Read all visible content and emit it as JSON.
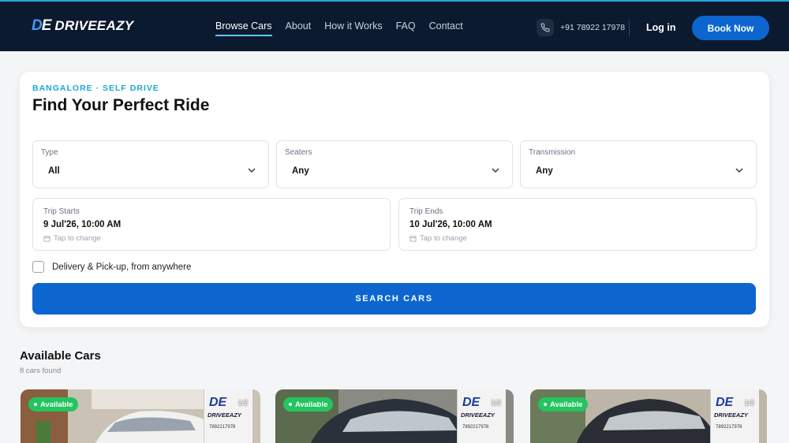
{
  "header": {
    "logo_mark_d": "D",
    "logo_mark_e": "E",
    "logo_text": "DRIVEEAZY",
    "nav": [
      {
        "label": "Browse Cars",
        "active": true
      },
      {
        "label": "About",
        "active": false
      },
      {
        "label": "How it Works",
        "active": false
      },
      {
        "label": "FAQ",
        "active": false
      },
      {
        "label": "Contact",
        "active": false
      }
    ],
    "phone": "+91 78922 17978",
    "login_label": "Log in",
    "book_label": "Book Now"
  },
  "search": {
    "eyebrow": "BANGALORE · SELF DRIVE",
    "title": "Find Your Perfect Ride",
    "filters": [
      {
        "label": "Type",
        "value": "All"
      },
      {
        "label": "Seaters",
        "value": "Any"
      },
      {
        "label": "Transmission",
        "value": "Any"
      }
    ],
    "trip_start": {
      "label": "Trip Starts",
      "value": "9 Jul'26, 10:00 AM",
      "hint": "Tap to change"
    },
    "trip_end": {
      "label": "Trip Ends",
      "value": "10 Jul'26, 10:00 AM",
      "hint": "Tap to change"
    },
    "delivery_label": "Delivery & Pick-up, from anywhere",
    "delivery_checked": false,
    "button_label": "SEARCH CARS"
  },
  "results": {
    "title": "Available Cars",
    "count": "8 cars found",
    "cars": [
      {
        "status": "Available",
        "counter": "1/2",
        "banner_logo": "DE",
        "banner_name": "DRIVEEAZY",
        "banner_phone": "7892217978"
      },
      {
        "status": "Available",
        "counter": "1/2",
        "banner_logo": "DE",
        "banner_name": "DRIVEEAZY",
        "banner_phone": "7892217978"
      },
      {
        "status": "Available",
        "counter": "1/2",
        "banner_logo": "DE",
        "banner_name": "DRIVEEAZY",
        "banner_phone": "7892217978"
      }
    ]
  },
  "colors": {
    "accent": "#0d66cf",
    "header_bg": "#0c1a2f",
    "eyebrow": "#1ba7d6",
    "available": "#22c55e"
  }
}
